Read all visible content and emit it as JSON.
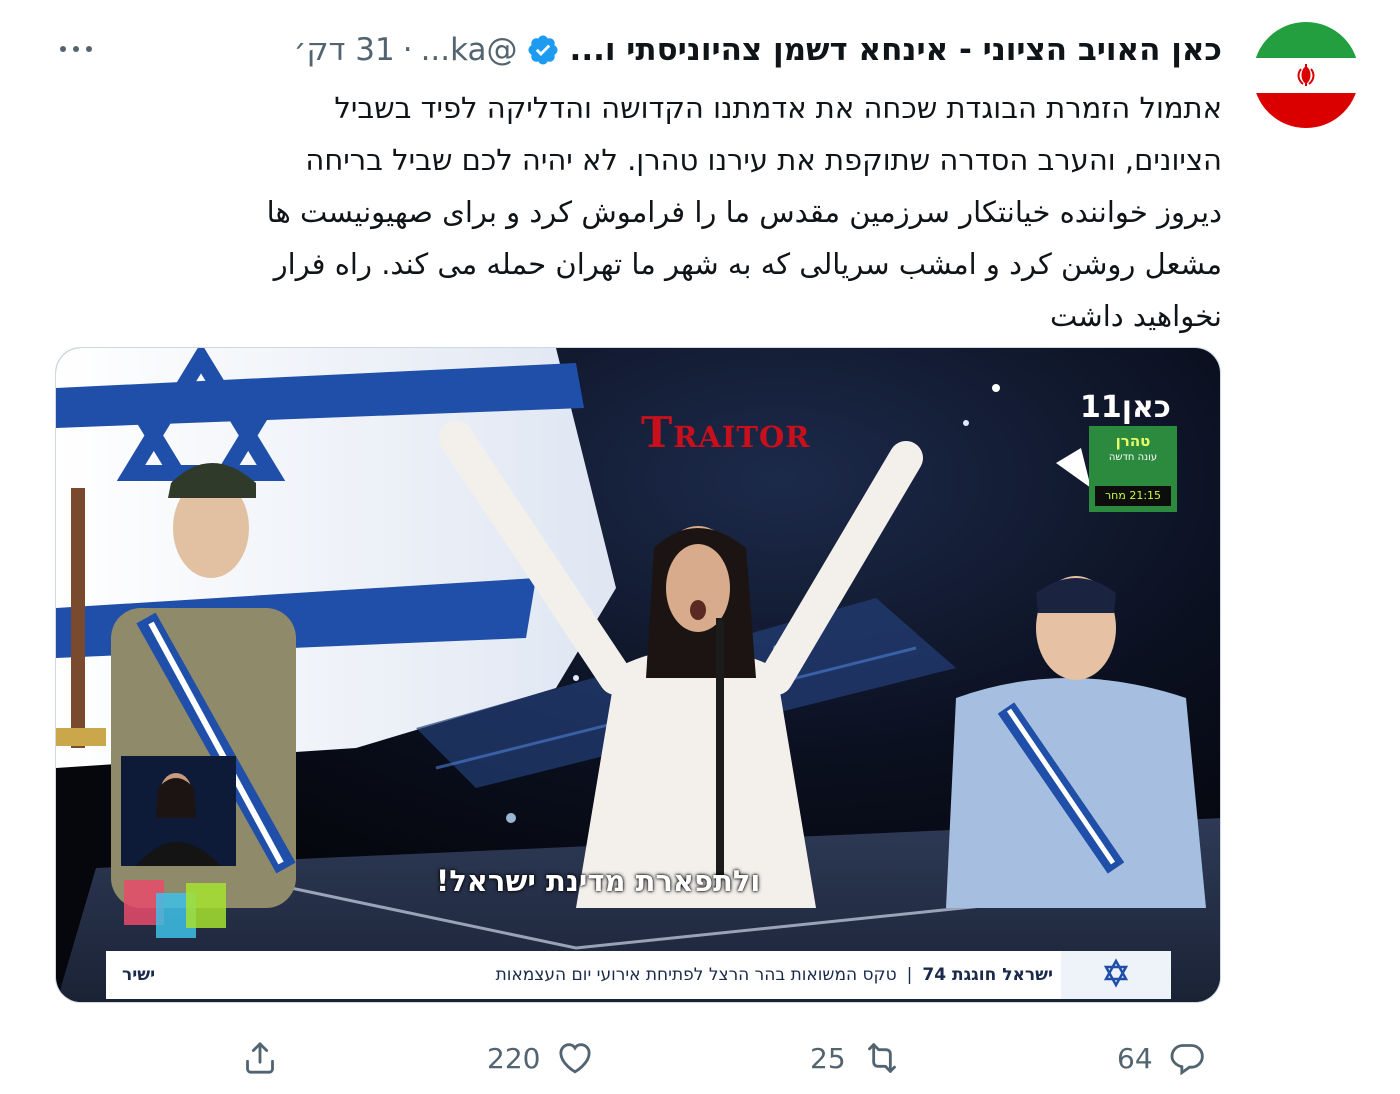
{
  "tweet": {
    "author_name": "כאן האויב הציוני - אינחא דשמן צהיוניסתי ו...",
    "handle": "@ka...",
    "time": "31 דק׳",
    "separator": "·",
    "text_lines": [
      "אתמול הזמרת הבוגדת שכחה את אדמתנו הקדושה והדליקה לפיד בשביל",
      "הציונים, והערב הסדרה שתוקפת את עירנו טהרן. לא יהיה לכם שביל בריחה",
      "دیروز خواننده خیانتکار سرزمین مقدس ما را فراموش کرد و برای صهیونیست ها",
      "مشعل روشن کرد و امشب سریالی که به شهر ما تهران حمله می کند. راه فرار",
      "نخواهید داشت"
    ]
  },
  "media": {
    "overlay_word": "Traitor",
    "subtitle": "ולתפארת מדינת ישראל!",
    "channel_logo": "כאן11",
    "promo": {
      "title": "טהרן",
      "subtitle": "עונה חדשה",
      "time": "21:15 מחר"
    },
    "ticker": {
      "headline": "ישראל חוגגת 74",
      "story": "טקס המשואות בהר הרצל לפתיחת אירועי יום העצמאות",
      "live": "ישיר"
    }
  },
  "actions": {
    "reply_count": "64",
    "retweet_count": "25",
    "like_count": "220"
  },
  "colors": {
    "text": "#0f1419",
    "secondary": "#536471",
    "verified": "#1d9bf0",
    "traitor": "#c8101c",
    "israel_blue": "#1f4fa8"
  },
  "icons": [
    "iran-flag-avatar",
    "verified-icon",
    "more-icon",
    "reply-icon",
    "retweet-icon",
    "like-icon",
    "share-icon"
  ]
}
